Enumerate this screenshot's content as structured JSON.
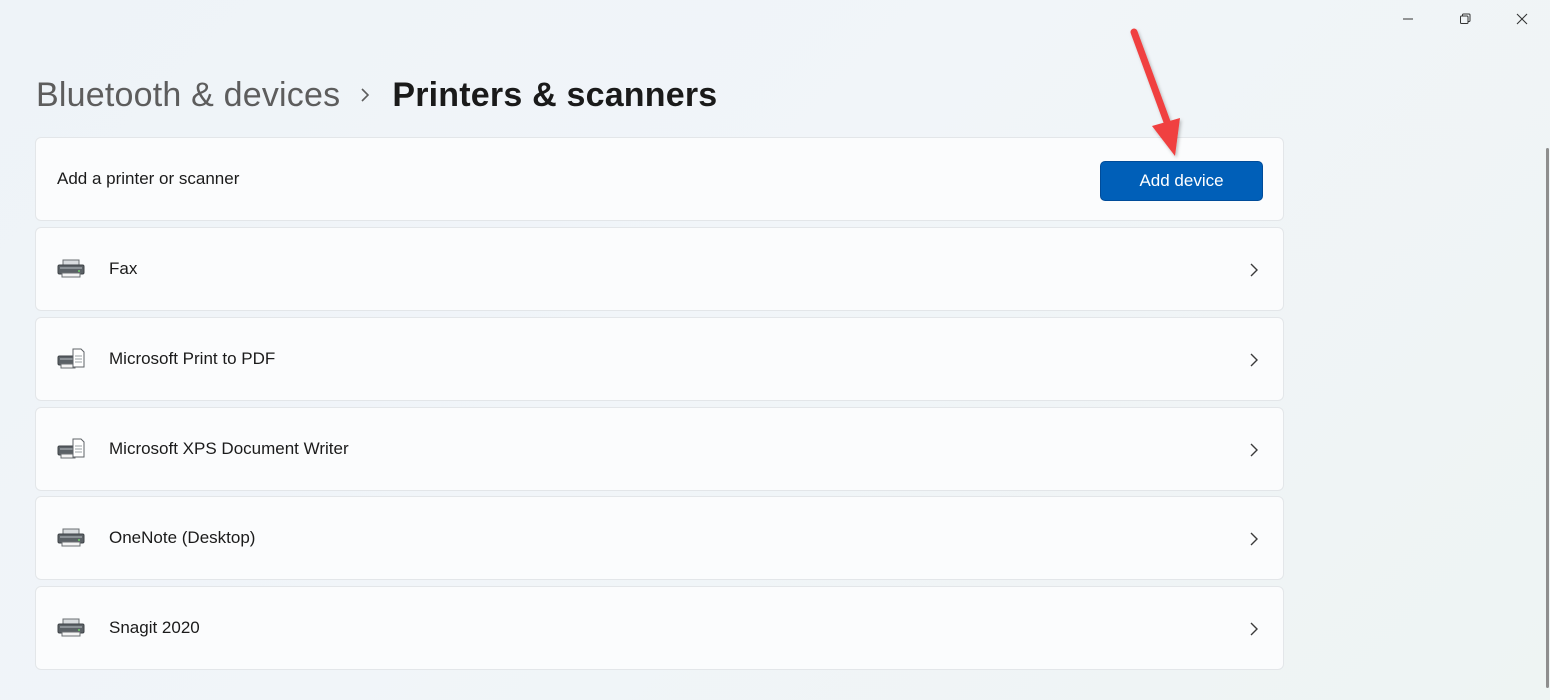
{
  "window": {
    "controls": [
      "minimize",
      "restore",
      "close"
    ]
  },
  "breadcrumb": {
    "parent": "Bluetooth & devices",
    "current": "Printers & scanners"
  },
  "add_section": {
    "label": "Add a printer or scanner",
    "button_label": "Add device"
  },
  "devices": [
    {
      "name": "Fax",
      "icon": "printer-icon"
    },
    {
      "name": "Microsoft Print to PDF",
      "icon": "printer-document-icon"
    },
    {
      "name": "Microsoft XPS Document Writer",
      "icon": "printer-document-icon"
    },
    {
      "name": "OneNote (Desktop)",
      "icon": "printer-icon"
    },
    {
      "name": "Snagit 2020",
      "icon": "printer-icon"
    }
  ],
  "colors": {
    "accent": "#005fb8",
    "annotation_arrow": "#f0413f"
  }
}
